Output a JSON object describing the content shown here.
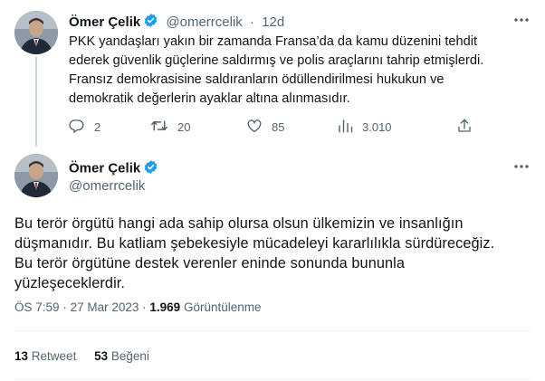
{
  "tweet1": {
    "author_name": "Ömer Çelik",
    "handle": "@omerrcelik",
    "separator": "·",
    "time": "12d",
    "text": "PKK yandaşları yakın bir zamanda Fransa’da da kamu düzenini tehdit\nederek güvenlik güçlerine saldırmış ve polis araçlarını tahrip etmişlerdi.\nFransız demokrasisine saldıranların ödüllendirilmesi hukukun ve\ndemokratik değerlerin ayaklar altına alınmasıdır.",
    "actions": {
      "replies": "2",
      "retweets": "20",
      "likes": "85",
      "views": "3.010"
    },
    "icons": [
      "reply-icon",
      "retweet-icon",
      "like-icon",
      "views-icon",
      "share-icon",
      "more-icon",
      "verified-badge-icon"
    ]
  },
  "tweet2": {
    "author_name": "Ömer Çelik",
    "handle": "@omerrcelik",
    "text": "Bu terör örgütü hangi ada sahip olursa olsun ülkemizin ve insanlığın\ndüşmanıdır. Bu katliam şebekesiyle mücadeleyi kararlılıkla sürdüreceğiz.\nBu terör örgütüne destek verenler eninde sonunda bununla\nyüzleşeceklerdir.",
    "time": "ÖS 7:59",
    "separator": "·",
    "date": "27 Mar 2023",
    "views_count": "1.969",
    "views_label": "Görüntülenme",
    "retweet_count": "13",
    "retweet_label": "Retweet",
    "like_count": "53",
    "like_label": "Beğeni"
  },
  "colors": {
    "text": "#0f1419",
    "muted": "#536471",
    "verified": "#1d9bf0",
    "divider": "#eff3f4"
  }
}
